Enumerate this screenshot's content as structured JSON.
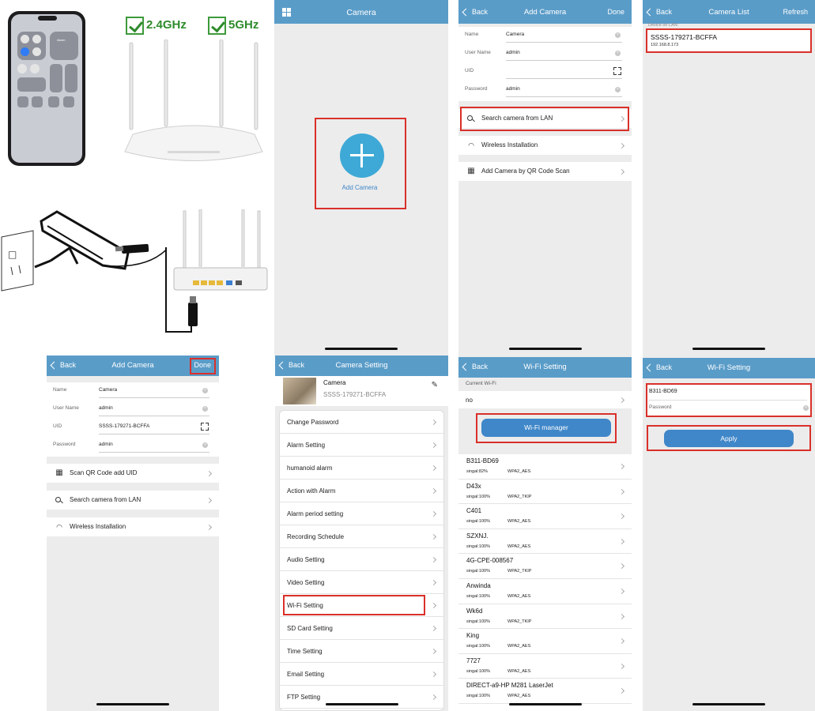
{
  "illustration": {
    "band_24": "2.4GHz",
    "band_5": "5GHz",
    "phone_alarm_label": "Alarm"
  },
  "camera_home": {
    "title": "Camera",
    "add_label": "Add Camera"
  },
  "add_camera_1": {
    "back": "Back",
    "title": "Add Camera",
    "done": "Done",
    "fields": [
      {
        "label": "Name",
        "value": "Camera"
      },
      {
        "label": "User Name",
        "value": "admin"
      },
      {
        "label": "UID",
        "value": ""
      },
      {
        "label": "Password",
        "value": "admin"
      }
    ],
    "menu": [
      "Search camera from LAN",
      "Wireless Installation",
      "Add Camera by QR Code Scan"
    ]
  },
  "camera_list": {
    "back": "Back",
    "title": "Camera List",
    "refresh": "Refresh",
    "section": "Device on LAN:",
    "device_name": "SSSS-179271-BCFFA",
    "device_ip": "192.168.8.173"
  },
  "add_camera_2": {
    "back": "Back",
    "title": "Add Camera",
    "done": "Done",
    "fields": [
      {
        "label": "Name",
        "value": "Camera"
      },
      {
        "label": "User Name",
        "value": "admin"
      },
      {
        "label": "UID",
        "value": "SSSS-179271-BCFFA"
      },
      {
        "label": "Password",
        "value": "admin"
      }
    ],
    "menu": [
      "Scan QR Code add UID",
      "Search camera from LAN",
      "Wireless Installation"
    ]
  },
  "camera_setting": {
    "back": "Back",
    "title": "Camera Setting",
    "device_name": "Camera",
    "device_uid": "SSSS-179271-BCFFA",
    "items": [
      "Change Password",
      "Alarm Setting",
      "humanoid alarm",
      "Action with Alarm",
      "Alarm period setting",
      "Recording Schedule",
      "Audio Setting",
      "Video Setting",
      "Wi-Fi Setting",
      "SD Card Setting",
      "Time Setting",
      "Email Setting",
      "FTP Setting"
    ]
  },
  "wifi_setting": {
    "back": "Back",
    "title": "Wi-Fi Setting",
    "current_label": "Current Wi-Fi",
    "current_value": "no",
    "manager_button": "Wi-Fi manager",
    "networks": [
      {
        "name": "B311-BD69",
        "signal": "singal:82%",
        "enc": "WPA2_AES"
      },
      {
        "name": "D43x",
        "signal": "singal:100%",
        "enc": "WPA2_TKIP"
      },
      {
        "name": "C401",
        "signal": "singal:100%",
        "enc": "WPA2_AES"
      },
      {
        "name": "SZXNJ.",
        "signal": "singal:100%",
        "enc": "WPA2_AES"
      },
      {
        "name": "4G-CPE-008567",
        "signal": "singal:100%",
        "enc": "WPA2_TKIP"
      },
      {
        "name": "Anwinda",
        "signal": "singal:100%",
        "enc": "WPA2_AES"
      },
      {
        "name": "Wk6d",
        "signal": "singal:100%",
        "enc": "WPA2_TKIP"
      },
      {
        "name": "King",
        "signal": "singal:100%",
        "enc": "WPA2_AES"
      },
      {
        "name": "7727",
        "signal": "singal:100%",
        "enc": "WPA2_AES"
      },
      {
        "name": "DIRECT-a9-HP M281 LaserJet",
        "signal": "singal:100%",
        "enc": "WPA2_AES"
      }
    ]
  },
  "wifi_setting_2": {
    "back": "Back",
    "title": "Wi-Fi Setting",
    "ssid": "B311-BD69",
    "password_label": "Password",
    "apply": "Apply"
  },
  "colors": {
    "navbar": "#5a9cc8",
    "highlight": "#d9302a",
    "button": "#3f87c9",
    "check": "#2f8b2c"
  }
}
